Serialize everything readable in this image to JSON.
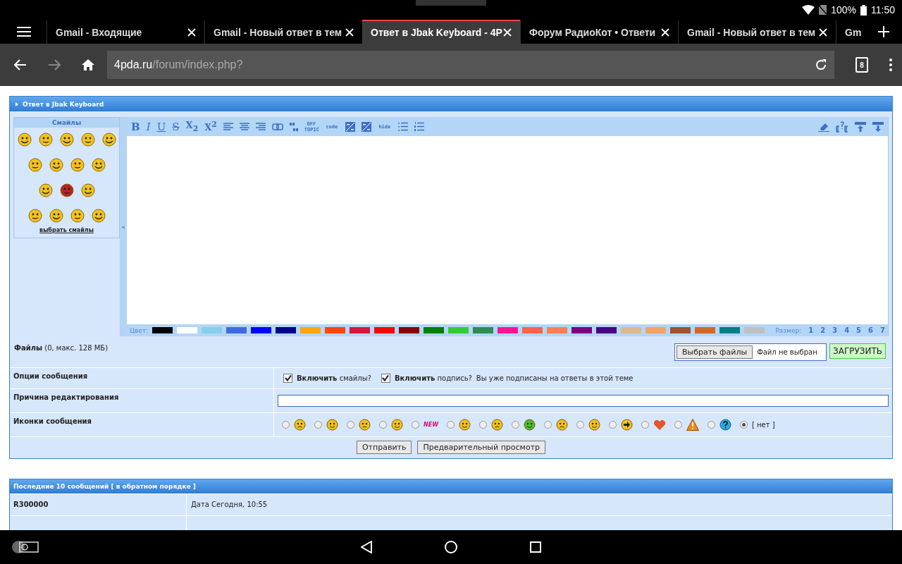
{
  "status_bar": {
    "battery": "100%",
    "time": "11:50"
  },
  "tabs": [
    {
      "title": "Gmail - Входящие",
      "selected": false,
      "closable": true
    },
    {
      "title": "Gmail - Новый ответ в тем",
      "selected": false,
      "closable": true
    },
    {
      "title": "Ответ в Jbak Keyboard - 4P",
      "selected": true,
      "closable": true
    },
    {
      "title": "Форум РадиоКот • Ответи",
      "selected": false,
      "closable": true
    },
    {
      "title": "Gmail - Новый ответ в тем",
      "selected": false,
      "closable": true
    },
    {
      "title": "Gm",
      "selected": false,
      "closable": false
    }
  ],
  "address_bar": {
    "host": "4pda.ru",
    "path": "/forum/index.php?",
    "tab_count": "8"
  },
  "reply_form": {
    "title": "Ответ в Jbak Keyboard",
    "smilies": {
      "title": "Смайлы",
      "link": "выбрать смайлы",
      "collapse": "«"
    },
    "toolbar_left": [
      {
        "kind": "bold",
        "label": "B"
      },
      {
        "kind": "italic",
        "label": "I"
      },
      {
        "kind": "underline",
        "label": "U"
      },
      {
        "kind": "strike",
        "label": "S"
      },
      {
        "kind": "script",
        "label": "X$_{2}$"
      },
      {
        "kind": "script",
        "label": "X$^{2}$"
      },
      {
        "kind": "align-left"
      },
      {
        "kind": "align-center"
      },
      {
        "kind": "align-right"
      },
      {
        "kind": "link"
      },
      {
        "kind": "quote"
      },
      {
        "kind": "tiny",
        "label": "OFF TOPIC"
      },
      {
        "kind": "tiny",
        "label": "code"
      },
      {
        "kind": "image"
      },
      {
        "kind": "image"
      },
      {
        "kind": "tiny",
        "label": "hide"
      },
      {
        "kind": "list"
      },
      {
        "kind": "numbered-list"
      }
    ],
    "toolbar_right": [
      {
        "kind": "eraser"
      },
      {
        "kind": "spoiler"
      },
      {
        "kind": "move-up"
      },
      {
        "kind": "move-down"
      }
    ],
    "color_label": "Цвет:",
    "colors": [
      {
        "color": "#000000"
      },
      {
        "color": "#ffffff"
      },
      {
        "color": "#87ceeb"
      },
      {
        "color": "#4169e1"
      },
      {
        "color": "#0000ff"
      },
      {
        "color": "#00008b"
      },
      {
        "color": "#ffa500"
      },
      {
        "color": "#ff4500"
      },
      {
        "color": "#dc143c"
      },
      {
        "color": "#ff0000"
      },
      {
        "color": "#8b0000"
      },
      {
        "color": "#008000"
      },
      {
        "color": "#32cd32"
      },
      {
        "color": "#2e8b57"
      },
      {
        "color": "#ff1493"
      },
      {
        "color": "#ff6347"
      },
      {
        "color": "#ff7f50"
      },
      {
        "color": "#800080"
      },
      {
        "color": "#4b0082"
      },
      {
        "color": "#deb887"
      },
      {
        "color": "#f4a460"
      },
      {
        "color": "#a0522d"
      },
      {
        "color": "#d2691e"
      },
      {
        "color": "#008080"
      },
      {
        "color": "#c0c0c0"
      }
    ],
    "size_label": "Размер:",
    "sizes": [
      "1",
      "2",
      "3",
      "4",
      "5",
      "6",
      "7"
    ],
    "files": {
      "label": "**Файлы** (0, макс. 128 МБ)",
      "choose_button": "Выбрать файлы",
      "file_status": "Файл не выбран",
      "upload_button": "ЗАГРУЗИТЬ"
    },
    "options": [
      {
        "kind": "checkboxes",
        "label": "Опции сообщения",
        "items": [
          {
            "text": "**Включить** смайлы?",
            "checked": true
          },
          {
            "text": "**Включить** подпись?",
            "checked": true
          }
        ],
        "note": "Вы уже подписаны на ответы в этой теме"
      },
      {
        "kind": "text-field",
        "label": "Причина редактирования"
      },
      {
        "kind": "icons",
        "label": "Иконки сообщения",
        "icons": [
          {
            "kind": "smiley",
            "selected": false
          },
          {
            "kind": "smiley",
            "selected": false
          },
          {
            "kind": "smiley",
            "selected": false
          },
          {
            "kind": "smiley",
            "selected": false
          },
          {
            "kind": "new",
            "label": "NEW",
            "selected": false
          },
          {
            "kind": "smiley",
            "selected": false
          },
          {
            "kind": "smiley",
            "selected": false
          },
          {
            "kind": "sick",
            "selected": false
          },
          {
            "kind": "smiley",
            "selected": false
          },
          {
            "kind": "smiley",
            "selected": false
          },
          {
            "kind": "arrow",
            "selected": false
          },
          {
            "kind": "heart",
            "selected": false
          },
          {
            "kind": "warning",
            "selected": false
          },
          {
            "kind": "question",
            "selected": false
          },
          {
            "kind": "none",
            "label": "[ нет ]",
            "selected": true
          }
        ]
      }
    ],
    "buttons": [
      "Отправить",
      "Предварительный просмотр"
    ]
  },
  "recent_posts": {
    "title": "Последние 10 сообщений [ в обратном порядке ]",
    "rows": [
      {
        "author": "R300000",
        "date": "Дата Сегодня, 10:55"
      }
    ]
  }
}
